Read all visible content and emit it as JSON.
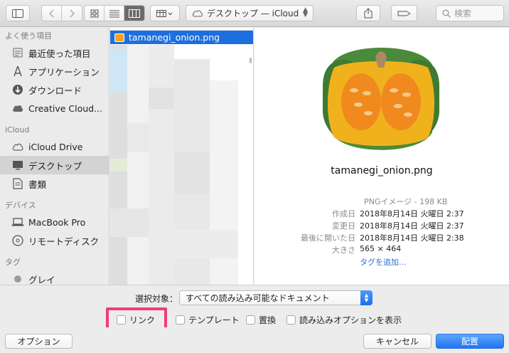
{
  "toolbar": {
    "location": "デスクトップ — iCloud",
    "search_placeholder": "検索"
  },
  "sidebar": {
    "sections": [
      {
        "header": "よく使う項目",
        "items": [
          "最近使った項目",
          "アプリケーション",
          "ダウンロード",
          "Creative Cloud..."
        ]
      },
      {
        "header": "iCloud",
        "items": [
          "iCloud Drive",
          "デスクトップ",
          "書類"
        ]
      },
      {
        "header": "デバイス",
        "items": [
          "MacBook Pro",
          "リモートディスク"
        ]
      },
      {
        "header": "タグ",
        "items": [
          "グレイ"
        ]
      }
    ],
    "selected": "デスクトップ"
  },
  "files": {
    "selected_file": "tamanegi_onion.png"
  },
  "preview": {
    "name": "tamanegi_onion.png",
    "kind": "PNGイメージ - 198 KB",
    "rows": [
      {
        "label": "作成日",
        "value": "2018年8月14日 火曜日 2:37"
      },
      {
        "label": "変更日",
        "value": "2018年8月14日 火曜日 2:37"
      },
      {
        "label": "最後に開いた日",
        "value": "2018年8月14日 火曜日 2:38"
      },
      {
        "label": "大きさ",
        "value": "565 × 464"
      }
    ],
    "add_tags": "タグを追加..."
  },
  "options": {
    "select_label": "選択対象：",
    "select_value": "すべての読み込み可能なドキュメント",
    "checkboxes": [
      "リンク",
      "テンプレート",
      "置換",
      "読み込みオプションを表示"
    ]
  },
  "buttons": {
    "options": "オプション",
    "cancel": "キャンセル",
    "place": "配置"
  },
  "colors": {
    "accent": "#1c6fde",
    "highlight": "#ef3f74"
  }
}
